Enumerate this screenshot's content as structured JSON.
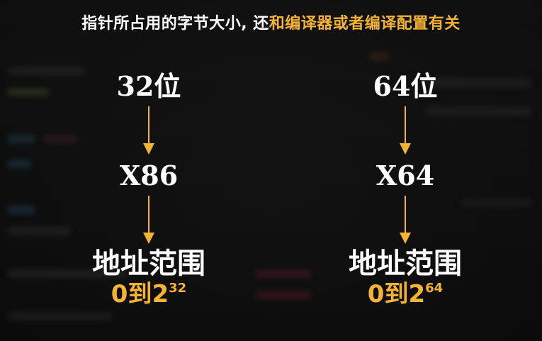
{
  "title": {
    "white_part": "指针所占用的字节大小, 还",
    "accent_part": "和编译器或者编译配置有关"
  },
  "columns": [
    {
      "top": "32位",
      "middle": "X86",
      "range_label": "地址范围",
      "range_prefix": "0到2",
      "range_exponent": "32"
    },
    {
      "top": "64位",
      "middle": "X64",
      "range_label": "地址范围",
      "range_prefix": "0到2",
      "range_exponent": "64"
    }
  ],
  "colors": {
    "accent": "#f5b335",
    "arrow": "#f5b335",
    "text": "#ffffff",
    "background": "#121212"
  },
  "icons": {
    "arrow": "arrow-down-icon"
  }
}
